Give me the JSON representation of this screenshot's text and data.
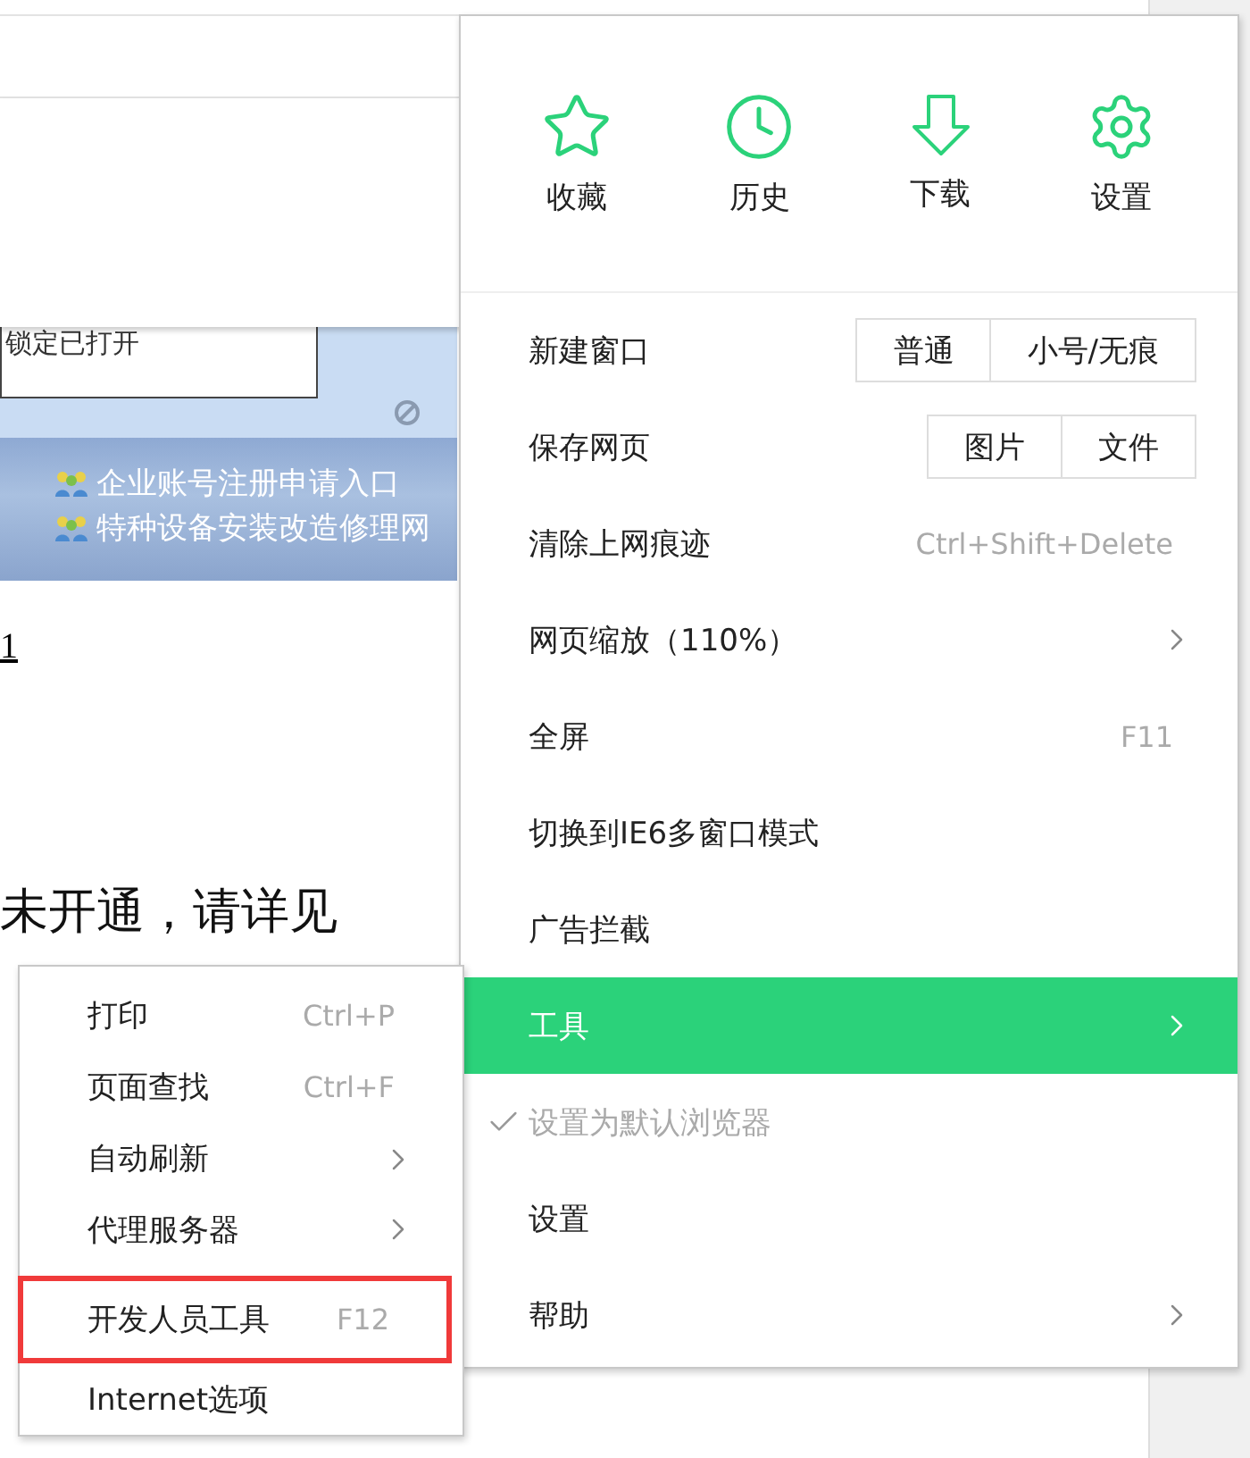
{
  "page": {
    "banner": {
      "notice": "锁定已打开",
      "links": [
        "企业账号注册申请入口",
        "特种设备安装改造修理网"
      ]
    },
    "link_text": "1",
    "paragraph": "未开通，请详见"
  },
  "main_menu": {
    "quick_actions": [
      {
        "label": "收藏"
      },
      {
        "label": "历史"
      },
      {
        "label": "下载"
      },
      {
        "label": "设置"
      }
    ],
    "items": [
      {
        "kind": "buttons",
        "label": "新建窗口",
        "buttons": [
          "普通",
          "小号/无痕"
        ],
        "selected": false,
        "disabled": false
      },
      {
        "kind": "buttons",
        "label": "保存网页",
        "buttons": [
          "图片",
          "文件"
        ],
        "selected": false,
        "disabled": false
      },
      {
        "kind": "shortcut",
        "label": "清除上网痕迹",
        "shortcut": "Ctrl+Shift+Delete",
        "selected": false,
        "disabled": false
      },
      {
        "kind": "submenu",
        "label": "网页缩放（110%）",
        "selected": false,
        "disabled": false
      },
      {
        "kind": "shortcut",
        "label": "全屏",
        "shortcut": "F11",
        "selected": false,
        "disabled": false
      },
      {
        "kind": "plain",
        "label": "切换到IE6多窗口模式",
        "selected": false,
        "disabled": false
      },
      {
        "kind": "plain",
        "label": "广告拦截",
        "selected": false,
        "disabled": false
      },
      {
        "kind": "submenu",
        "label": "工具",
        "selected": true,
        "disabled": false
      },
      {
        "kind": "check",
        "label": "设置为默认浏览器",
        "checked": true,
        "selected": false,
        "disabled": true
      },
      {
        "kind": "plain",
        "label": "设置",
        "selected": false,
        "disabled": false
      },
      {
        "kind": "submenu",
        "label": "帮助",
        "selected": false,
        "disabled": false
      }
    ]
  },
  "tools_submenu": {
    "items": [
      {
        "kind": "shortcut",
        "label": "打印",
        "shortcut": "Ctrl+P",
        "outlined": false
      },
      {
        "kind": "shortcut",
        "label": "页面查找",
        "shortcut": "Ctrl+F",
        "outlined": false
      },
      {
        "kind": "submenu",
        "label": "自动刷新",
        "outlined": false
      },
      {
        "kind": "submenu",
        "label": "代理服务器",
        "outlined": false
      },
      {
        "kind": "shortcut",
        "label": "开发人员工具",
        "shortcut": "F12",
        "outlined": true
      },
      {
        "kind": "plain",
        "label": "Internet选项",
        "outlined": false
      }
    ]
  }
}
